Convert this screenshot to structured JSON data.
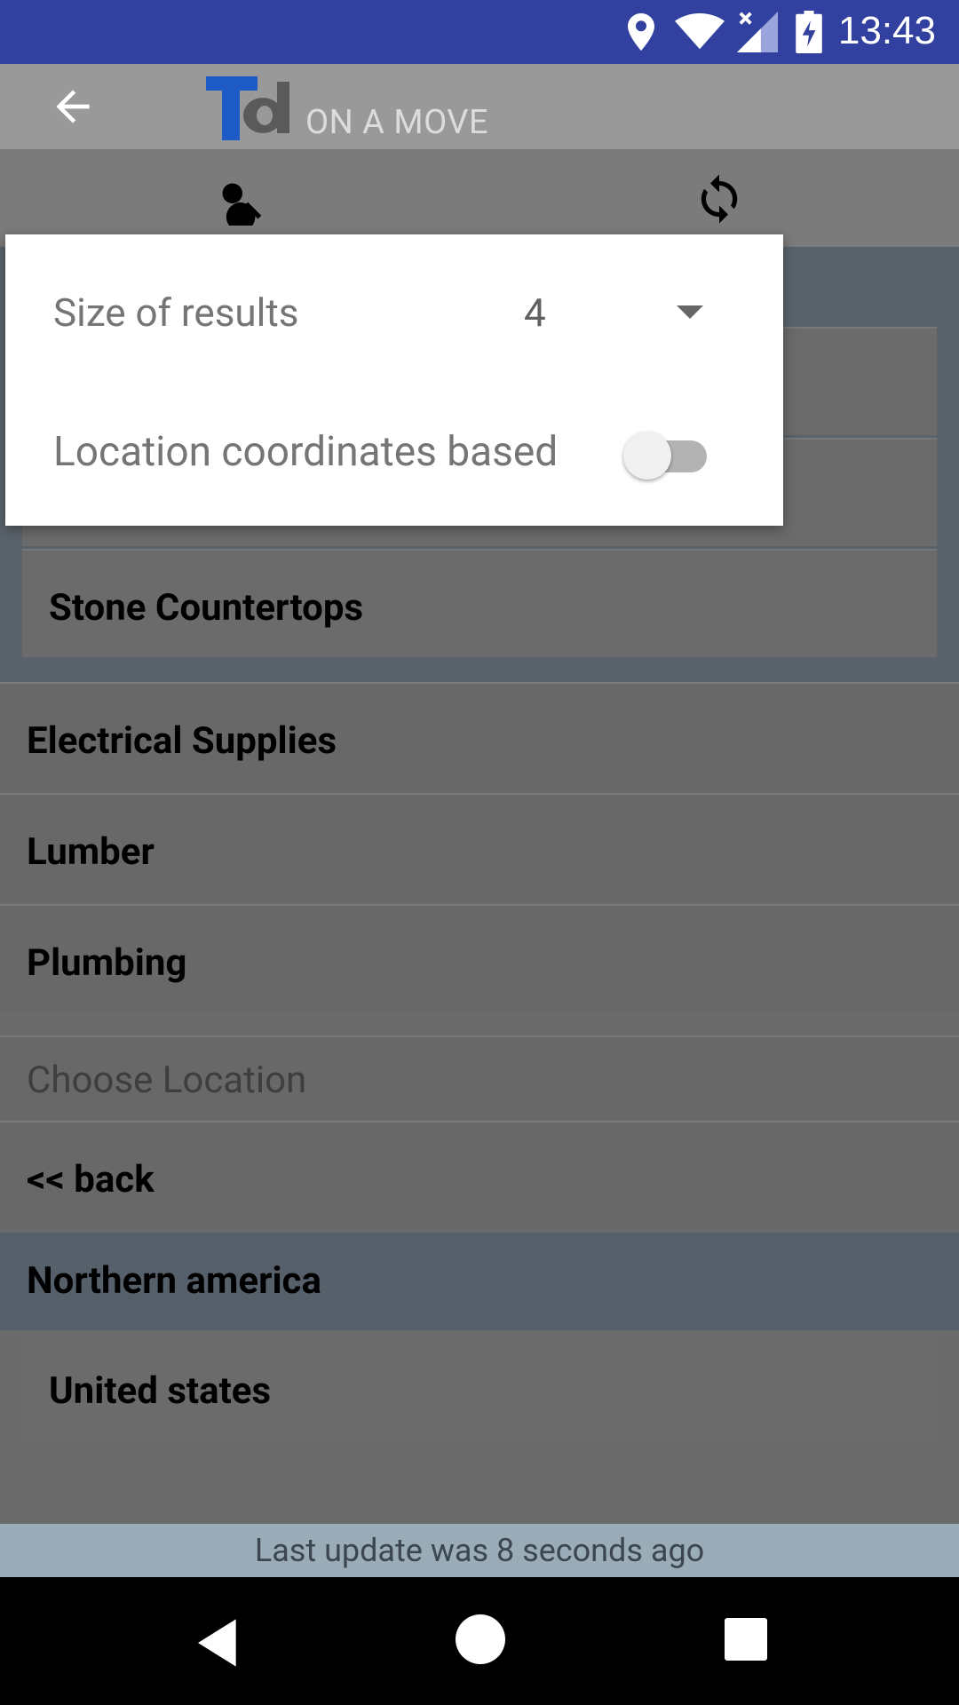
{
  "status_bar": {
    "time": "13:43"
  },
  "app_bar": {
    "logo_text": "Td",
    "subtitle": "ON A MOVE"
  },
  "toolbar": {},
  "list": {
    "sub_items": [
      "Stone Countertops"
    ],
    "categories": [
      "Electrical Supplies",
      "Lumber",
      "Plumbing"
    ],
    "choose_location": "Choose Location",
    "back": "<< back",
    "region": "Northern america",
    "country": "United states"
  },
  "dialog": {
    "size_label": "Size of results",
    "size_value": "4",
    "location_label": "Location coordinates based",
    "location_enabled": false
  },
  "footer": {
    "status": "Last update was 8 seconds ago"
  },
  "colors": {
    "status_bar": "#32409f",
    "accent_blue": "#1f5bc4"
  }
}
